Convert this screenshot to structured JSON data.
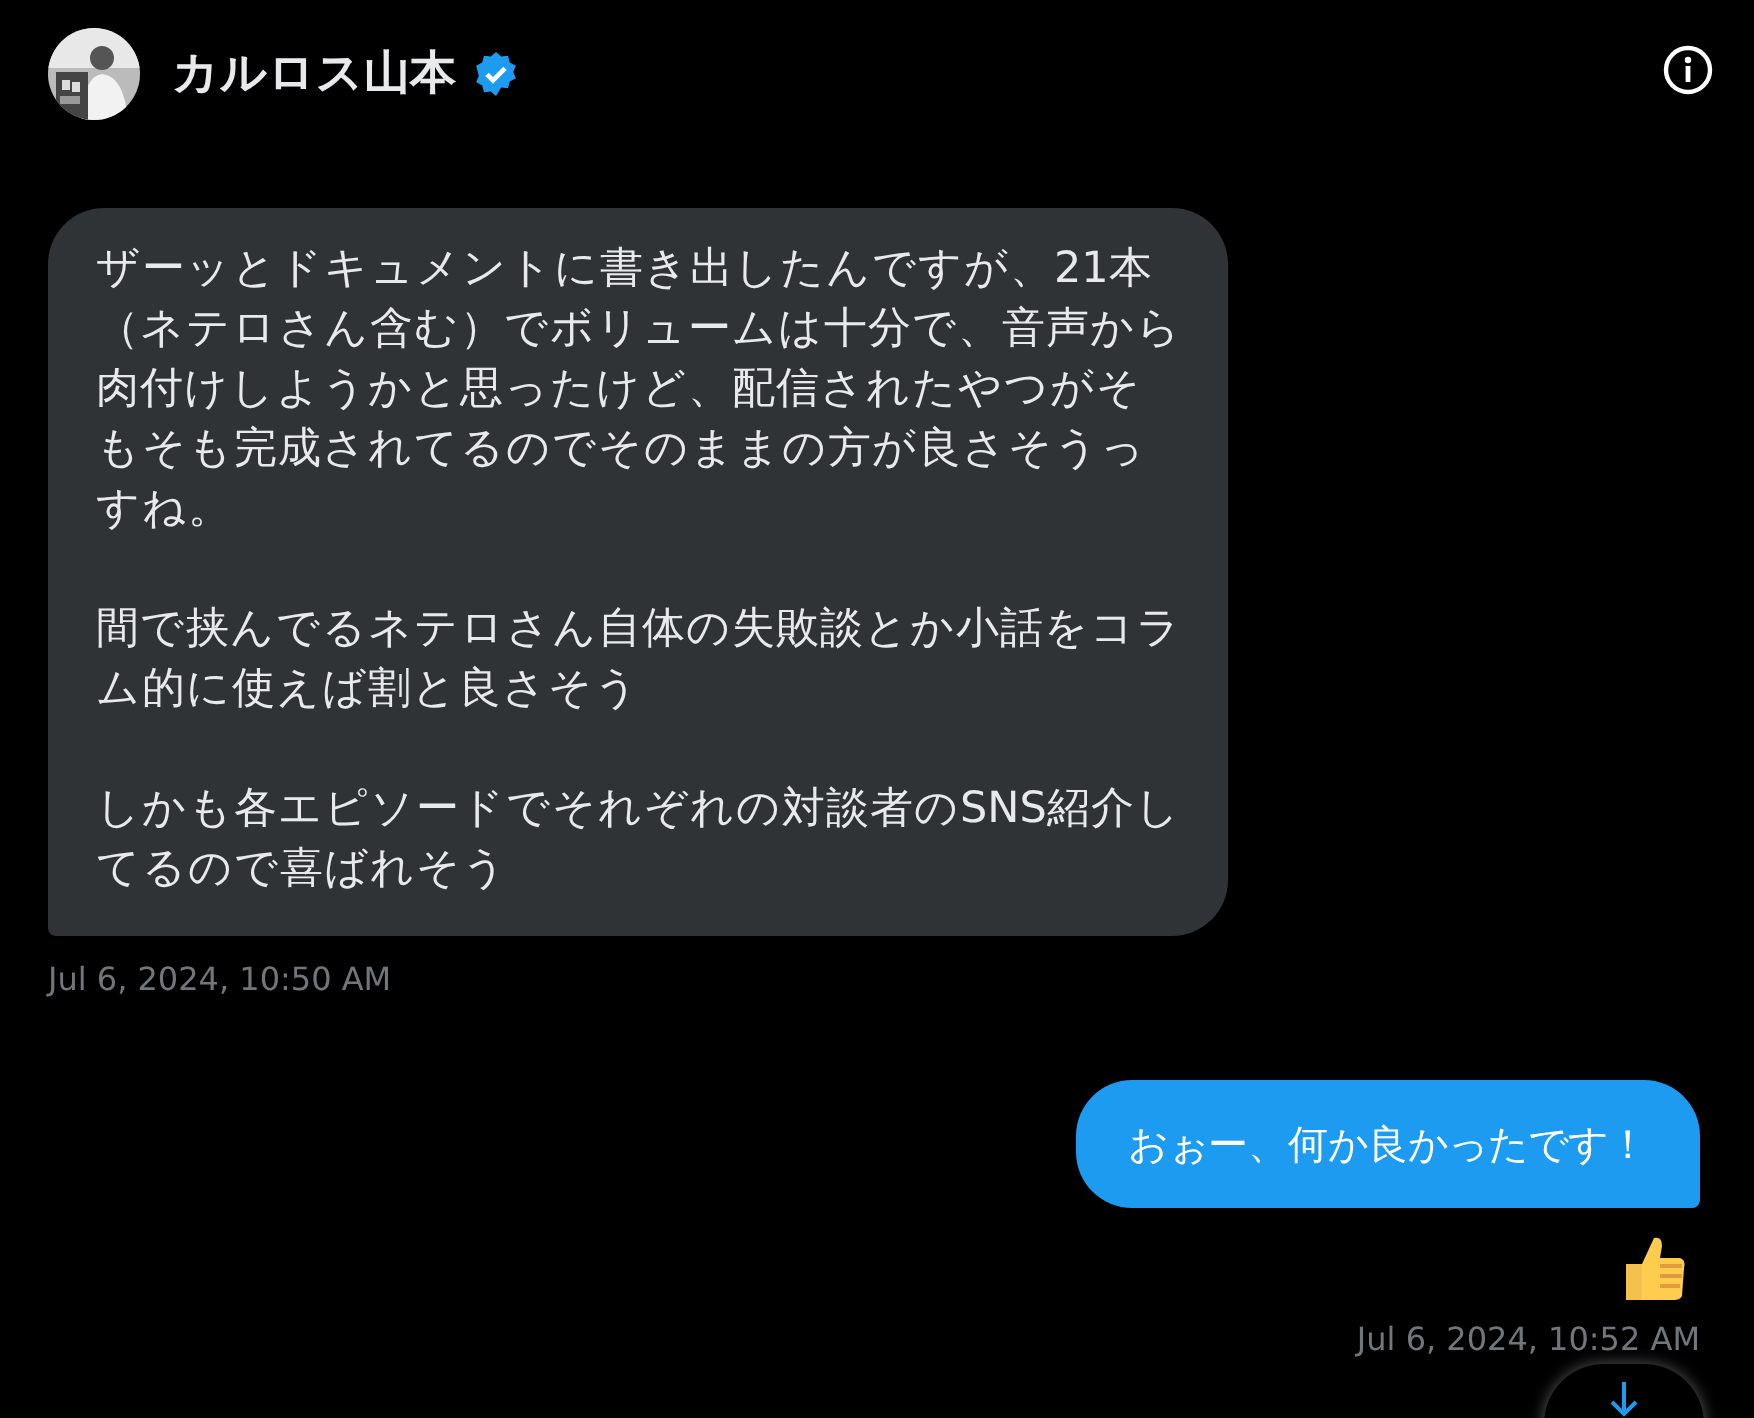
{
  "header": {
    "name": "カルロス山本",
    "verified": true
  },
  "messages": [
    {
      "kind": "received",
      "paragraphs": [
        "ザーッとドキュメントに書き出したんですが、21本（ネテロさん含む）でボリュームは十分で、音声から肉付けしようかと思ったけど、配信されたやつがそもそも完成されてるのでそのままの方が良さそうっすね。",
        "間で挟んでるネテロさん自体の失敗談とか小話をコラム的に使えば割と良さそう",
        "しかも各エピソードでそれぞれの対談者のSNS紹介してるので喜ばれそう"
      ],
      "time": "Jul 6, 2024, 10:50 AM"
    },
    {
      "kind": "sent",
      "paragraphs": [
        "おぉー、何か良かったです！"
      ],
      "thumbs_up_reaction": true,
      "time": "Jul 6, 2024, 10:52 AM"
    }
  ]
}
